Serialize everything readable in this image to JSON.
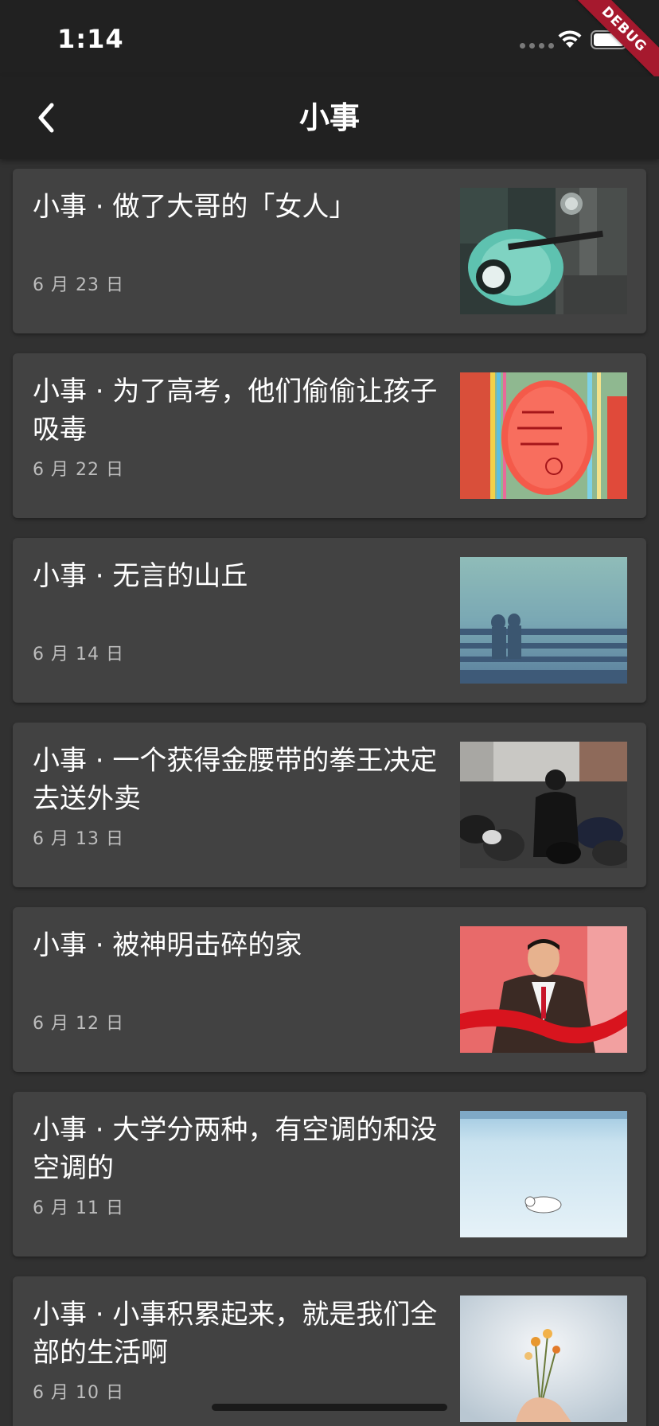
{
  "status_bar": {
    "time": "1:14",
    "debug_label": "DEBUG"
  },
  "app_bar": {
    "title": "小事",
    "back_icon": "chevron-left-icon"
  },
  "articles": [
    {
      "title": "小事 · 做了大哥的「女人」",
      "date": "6 月 23 日",
      "thumbnail": "scooter-photo"
    },
    {
      "title": "小事 · 为了高考，他们偷偷让孩子吸毒",
      "date": "6 月 22 日",
      "thumbnail": "wish-tags-photo"
    },
    {
      "title": "小事 · 无言的山丘",
      "date": "6 月 14 日",
      "thumbnail": "beach-shadow-photo"
    },
    {
      "title": "小事 · 一个获得金腰带的拳王决定去送外卖",
      "date": "6 月 13 日",
      "thumbnail": "motorbike-lot-photo"
    },
    {
      "title": "小事 · 被神明击碎的家",
      "date": "6 月 12 日",
      "thumbnail": "man-ribbon-photo"
    },
    {
      "title": "小事 · 大学分两种，有空调的和没空调的",
      "date": "6 月 11 日",
      "thumbnail": "pool-bear-photo"
    },
    {
      "title": "小事 · 小事积累起来，就是我们全部的生活啊",
      "date": "6 月 10 日",
      "thumbnail": "flower-hand-photo"
    }
  ]
}
